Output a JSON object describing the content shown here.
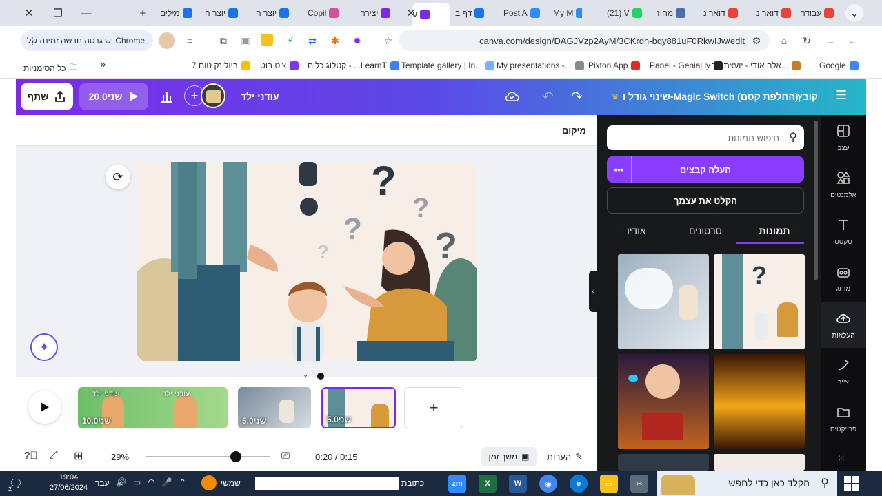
{
  "browser": {
    "tabs": [
      {
        "label": "עבודה",
        "color": "#ea4335"
      },
      {
        "label": "דואר נ",
        "color": "#ea4335"
      },
      {
        "label": "דואר נ",
        "color": "#ea4335"
      },
      {
        "label": "מחוז",
        "color": "#4c6fa8"
      },
      {
        "label": "(21) V",
        "color": "#25d366"
      },
      {
        "label": "My M",
        "color": "#2d8cff"
      },
      {
        "label": "Post A",
        "color": "#2d8cff"
      },
      {
        "label": "דף ב",
        "color": "#1a73e8"
      },
      {
        "label": "ע",
        "color": "#7d2ae8"
      },
      {
        "label": "יצירה",
        "color": "#7d2ae8"
      },
      {
        "label": "Copil",
        "color": "#d64f9a"
      },
      {
        "label": "יוצר ה",
        "color": "#1a73e8"
      },
      {
        "label": "יוצר ה",
        "color": "#1a73e8"
      },
      {
        "label": "מילים",
        "color": "#1a73e8"
      }
    ],
    "update_label": "יש גרסה חדשה זמינה של Chrome",
    "url": "canva.com/design/DAGJVzp2AyM/3CKrdn-bqy881uF0RkwIJw/edit",
    "bookmarks": [
      {
        "label": "Google",
        "color": "#4285f4"
      },
      {
        "label": "אלה אודי - יועצת טכ...",
        "color": "#c77b2a"
      },
      {
        "label": "Panel - Genial.ly",
        "color": "#222"
      },
      {
        "label": "Pixton App",
        "color": "#d93025"
      },
      {
        "label": "My presentations -...",
        "color": "#8a8a8a"
      },
      {
        "label": "Template gallery | In...",
        "color": "#7ab1ff"
      },
      {
        "label": "קטלוג כלים - ...LearnT",
        "color": "#3b82f6"
      },
      {
        "label": "צ'ט בוט",
        "color": "#7c3aed"
      },
      {
        "label": "ביולינק טום 7",
        "color": "#fbbc05"
      }
    ],
    "bookmarks_more": "»",
    "all_bookmarks": "כל הסימניות"
  },
  "canva": {
    "header": {
      "menu_file": "קובץ",
      "design_title": "שינוי גודל ו-Magic Switch (החלפת קסם)",
      "project_name": "עודני ילד",
      "present_label": "20.0שני",
      "share_label": "שתף"
    },
    "subheader": {
      "position_label": "מיקום"
    },
    "timeline": {
      "clips": [
        {
          "title": "עודני ילד",
          "title2": "עודני ילד",
          "duration": "10.0שני"
        },
        {
          "duration": "5.0שני"
        },
        {
          "duration": "5.0שני"
        }
      ],
      "add_label": "+"
    },
    "bottom_bar": {
      "zoom": "29%",
      "zoom_level": 0.29,
      "time": "0:20 / 0:15",
      "timeline_label": "משך זמן",
      "notes_label": "הערות"
    },
    "uploads": {
      "search_placeholder": "חיפוש תמונות",
      "upload_label": "העלה קבצים",
      "record_label": "הקלט את עצמך",
      "tabs": [
        "תמונות",
        "סרטונים",
        "אודיו"
      ],
      "active_tab": "תמונות"
    },
    "rail": [
      {
        "label": "עצב",
        "icon": "design-icon"
      },
      {
        "label": "אלמנטים",
        "icon": "elements-icon"
      },
      {
        "label": "טקסט",
        "icon": "text-icon"
      },
      {
        "label": "מותג",
        "icon": "brand-icon"
      },
      {
        "label": "העלאות",
        "icon": "upload-icon"
      },
      {
        "label": "צייר",
        "icon": "draw-icon"
      },
      {
        "label": "פרויקטים",
        "icon": "folder-icon"
      }
    ]
  },
  "taskbar": {
    "search_placeholder": "הקלד כאן כדי לחפש",
    "address_label": "כתובת",
    "weather": "שמשי",
    "lang": "עבר",
    "time": "19:04",
    "date": "27/06/2024",
    "notification_count": "2"
  }
}
